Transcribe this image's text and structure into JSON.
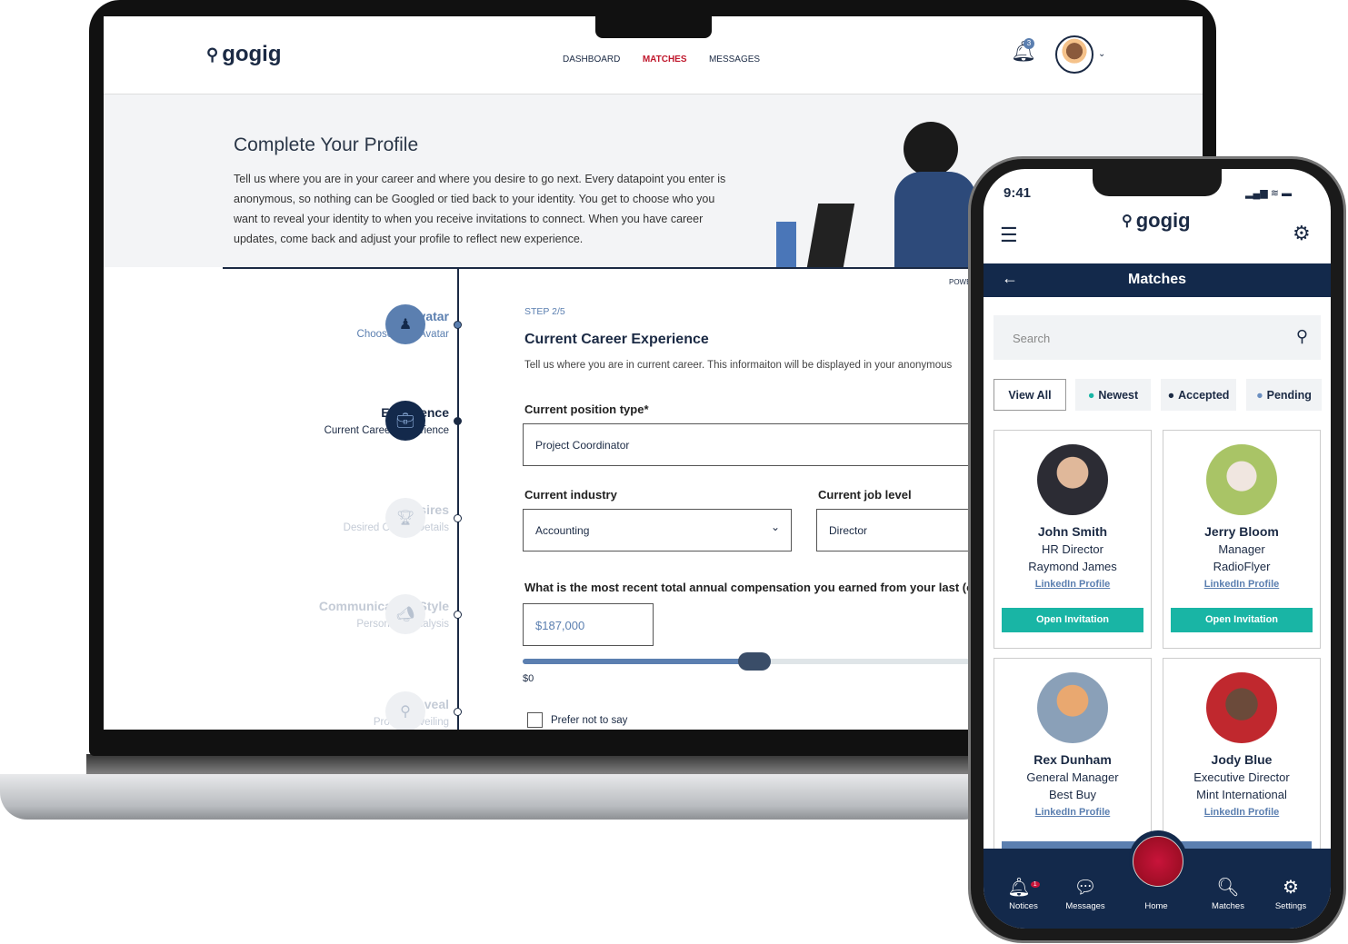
{
  "laptop": {
    "logo": "gogig",
    "nav": [
      "DASHBOARD",
      "MATCHES",
      "MESSAGES"
    ],
    "active_nav": "MATCHES",
    "notification_count": "3",
    "hero": {
      "title": "Complete Your Profile",
      "text": "Tell us where you are in your career and where you desire to go next. Every datapoint you enter is anonymous, so nothing can be Googled or tied back to your identity. You get to choose who you want to reveal your identity to when you receive invitations to connect. When you have career updates, come back and adjust your profile to reflect new experience."
    },
    "powered": "POWER",
    "steps": [
      {
        "title": "Avatar",
        "subtitle": "Choose Your Avatar"
      },
      {
        "title": "Experience",
        "subtitle": "Current Career Experience"
      },
      {
        "title": "Desires",
        "subtitle": "Desired Career Details"
      },
      {
        "title": "Communication Style",
        "subtitle": "Personality analysis"
      },
      {
        "title": "Reveal",
        "subtitle": "Profile Unveiling"
      }
    ],
    "form": {
      "step": "STEP 2/5",
      "title": "Current Career Experience",
      "desc": "Tell us where you are in current career. This informaiton will be displayed in your anonymous",
      "position_label": "Current position type*",
      "position_value": "Project Coordinator",
      "industry_label": "Current industry",
      "industry_value": "Accounting",
      "level_label": "Current job level",
      "level_value": "Director",
      "comp_label": "What is the most recent total annual compensation you earned from your last (or",
      "comp_value": "$187,000",
      "slider_min": "$0",
      "slider_fraction": 0.51,
      "prefer_not": "Prefer not to say"
    }
  },
  "phone": {
    "time": "9:41",
    "logo": "gogig",
    "title": "Matches",
    "search_placeholder": "Search",
    "filters": [
      {
        "label": "View All"
      },
      {
        "label": "Newest",
        "color": "#19b5a5"
      },
      {
        "label": "Accepted",
        "color": "#1b2a44"
      },
      {
        "label": "Pending",
        "color": "#6b8fc0"
      }
    ],
    "cards": [
      {
        "name": "John Smith",
        "role": "HR Director",
        "company": "Raymond James",
        "link": "LinkedIn Profile",
        "button": "Open Invitation"
      },
      {
        "name": "Jerry Bloom",
        "role": "Manager",
        "company": "RadioFlyer",
        "link": "LinkedIn Profile",
        "button": "Open Invitation"
      },
      {
        "name": "Rex Dunham",
        "role": "General Manager",
        "company": "Best Buy",
        "link": "LinkedIn Profile"
      },
      {
        "name": "Jody Blue",
        "role": "Executive Director",
        "company": "Mint International",
        "link": "LinkedIn Profile"
      }
    ],
    "tabs": [
      "Notices",
      "Messages",
      "Home",
      "Matches",
      "Settings"
    ],
    "notice_badge": "1",
    "colors": {
      "navy": "#13294b",
      "teal": "#19b5a5",
      "red": "#b3102a"
    }
  }
}
